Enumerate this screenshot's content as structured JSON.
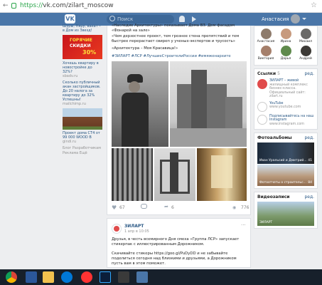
{
  "browser": {
    "back_label": "←",
    "url_host": "https://",
    "url_rest": "vk.com/zilart_moscow"
  },
  "header": {
    "logo": "VK",
    "search_placeholder": "Поиск",
    "user_name": "Анастасия"
  },
  "left_ads": [
    {
      "text": "Шуры, Няру, вахат – в Дом из Звезд!",
      "domain": ""
    },
    {
      "text": "Хочешь квартиру в новостройке до 32%?",
      "domain": "sbadv.ru"
    },
    {
      "text": "Сколько публичный акан застройщиков. До 20 налога за квартиру до 32% Успешны!",
      "domain": "mailchimp.ru"
    },
    {
      "text": "Проект дома СТ4 от 99 000 WOOD В",
      "domain": "gindi.ru"
    }
  ],
  "left_ad_banner": {
    "line1": "ГОРЯЧИЕ",
    "line2": "СКИДКИ",
    "line3": "30%"
  },
  "left_footer": "Блог Разработчикам Реклама Ещё",
  "post1": {
    "quote1": "«Наследие Архитектуры» показывает Дома ВЗ. Дом фасадом «Фонарей на зале»",
    "quote2": "«Чем дерзостнее проект, тем грознее стена препятствий и тем быстрее перерастает свиреп у ученых-экспертов и трусость»",
    "quote3": "«Архитектура – Моя Красавица!»",
    "tags": "#ЗИЛАРТ #ЛСР #ЛучшиеСтроителиРоссии #имяженархите",
    "likes": "67",
    "shares": "6",
    "views": "776"
  },
  "post2": {
    "author": "ЗИЛАРТ",
    "date": "1 апр в 10:05",
    "dots": "···",
    "text1": "Друзья, в честь всемирного Дня смеха «Группа ЛСР» запускает стикерпак с иллюстрированным Дорожником.",
    "text2": "Скачивайте стикеры https://goo.gl/PuDyDD и не забывайте поделиться сегодня над близкими и друзьями, а Дорожником пусть вам в этом поможет."
  },
  "friends": [
    {
      "name": "Анастасия"
    },
    {
      "name": "Ирина"
    },
    {
      "name": "Михаил"
    },
    {
      "name": "Виктория"
    },
    {
      "name": "Дарья"
    },
    {
      "name": "Андрей"
    }
  ],
  "links": {
    "title": "Ссылки",
    "count": "5",
    "more": "ред.",
    "items": [
      {
        "name": "ЗИЛАРТ – живой",
        "sub": "жилищный комплекс бизнес-класса. Официальный сайт: zilart.ru"
      },
      {
        "name": "YouTube",
        "sub": "www.youtube.com"
      },
      {
        "name": "Подписывайтесь на наш Instagram",
        "sub": "www.instagram.com"
      }
    ]
  },
  "albums": {
    "title": "Фотоальбомы",
    "count": "",
    "more": "ред.",
    "items": [
      {
        "caption": "Иван Уральсий и Дмитрий...",
        "count": "41"
      },
      {
        "caption": "Фотоотчеты о строительс...",
        "count": "84"
      }
    ]
  },
  "videos": {
    "title": "Видеозаписи",
    "count": "",
    "more": "ред.",
    "items": [
      {
        "caption": "ЗИЛАРТ",
        "count": ""
      }
    ]
  },
  "colors": {
    "vk_blue": "#4a76a8",
    "link": "#2a5885",
    "bg": "#edeef0"
  }
}
